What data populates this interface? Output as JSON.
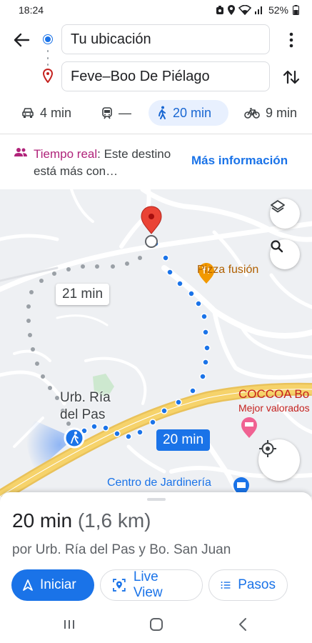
{
  "status_bar": {
    "time": "18:24",
    "battery": "52%",
    "icons": [
      "notification-icon",
      "location-icon",
      "wifi-icon",
      "signal-icon",
      "battery-icon"
    ]
  },
  "search": {
    "origin": "Tu ubicación",
    "destination": "Feve–Boo De Piélago"
  },
  "modes": [
    {
      "icon": "car-icon",
      "label": "4 min"
    },
    {
      "icon": "transit-icon",
      "label": "—"
    },
    {
      "icon": "walk-icon",
      "label": "20 min",
      "selected": true
    },
    {
      "icon": "bike-icon",
      "label": "9 min"
    }
  ],
  "banner": {
    "icon": "people-icon",
    "realtime_label": "Tiempo real",
    "text": ": Este destino está más con…",
    "more_info": "Más información"
  },
  "map": {
    "poi_pizza": "Pizza fusión",
    "poi_coccoa": "COCCOA Bo",
    "poi_coccoa_sub": "Mejor valorados",
    "poi_garden": "Centro de Jardinería",
    "place_urb": "Urb. Ría del Pas",
    "alt_time": "21 min",
    "main_time": "20 min"
  },
  "sheet": {
    "duration": "20 min",
    "distance": "(1,6 km)",
    "via": "por Urb. Ría del Pas y Bo. San Juan",
    "start_label": "Iniciar",
    "live_view_label": "Live View",
    "steps_label": "Pasos"
  },
  "colors": {
    "accent": "#1a73e8",
    "accent_light": "#e8f0fe",
    "highway": "#f6d36b",
    "realtime": "#b0237a",
    "pin": "#ea4335"
  }
}
